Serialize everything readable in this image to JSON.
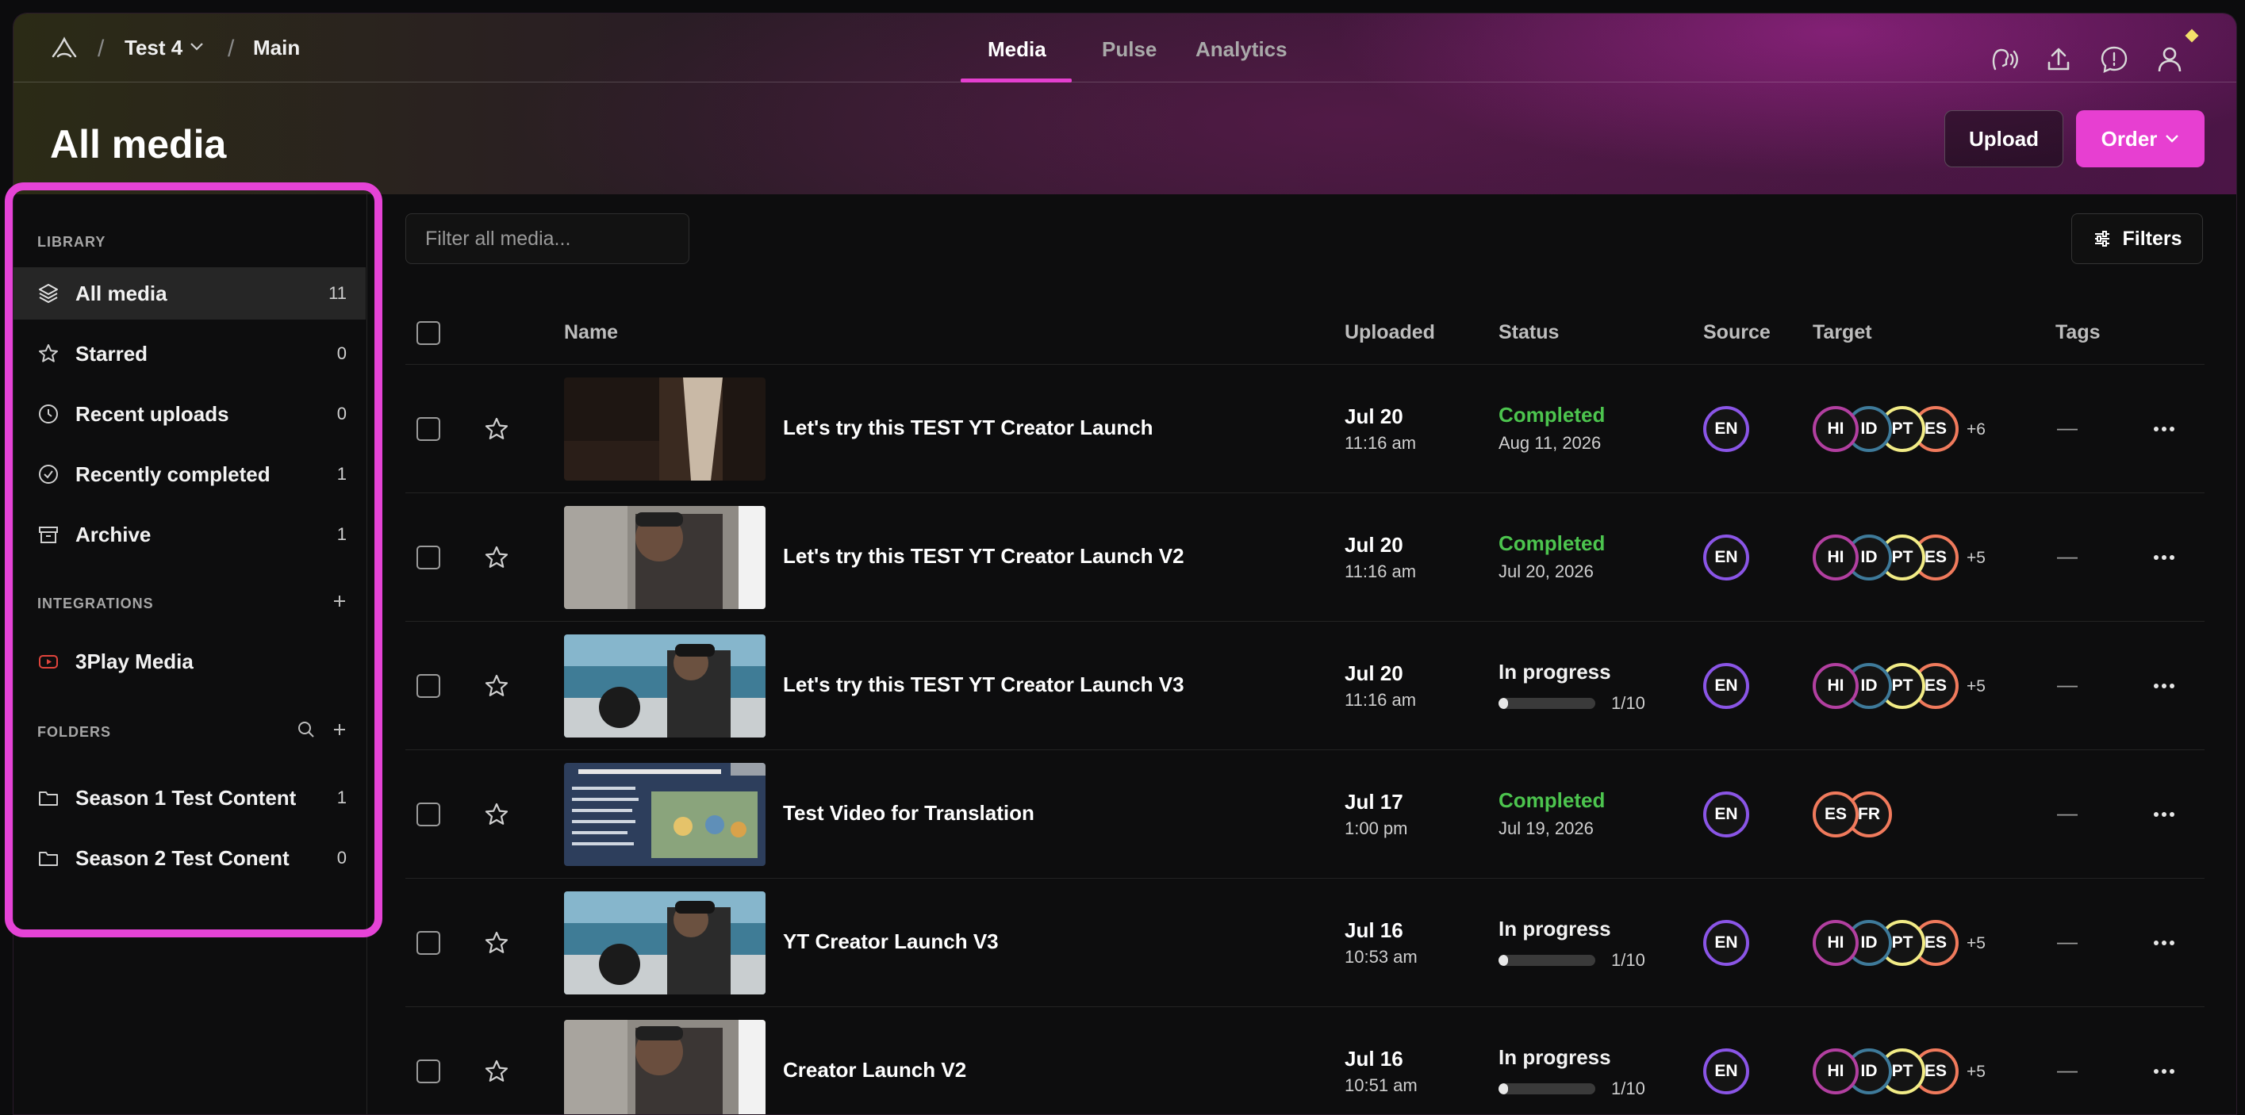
{
  "breadcrumb": {
    "workspace": "Test 4",
    "section": "Main"
  },
  "nav": {
    "tabs": [
      "Media",
      "Pulse",
      "Analytics"
    ],
    "active": "Media"
  },
  "page": {
    "title": "All media",
    "upload_label": "Upload",
    "order_label": "Order"
  },
  "sidebar": {
    "library_label": "LIBRARY",
    "items": [
      {
        "label": "All media",
        "count": "11",
        "icon": "layers-icon"
      },
      {
        "label": "Starred",
        "count": "0",
        "icon": "star-icon"
      },
      {
        "label": "Recent uploads",
        "count": "0",
        "icon": "clock-icon"
      },
      {
        "label": "Recently completed",
        "count": "1",
        "icon": "check-circle-icon"
      },
      {
        "label": "Archive",
        "count": "1",
        "icon": "archive-icon"
      }
    ],
    "integrations_label": "INTEGRATIONS",
    "integrations": [
      {
        "label": "3Play Media",
        "icon": "youtube-icon"
      }
    ],
    "folders_label": "FOLDERS",
    "folders": [
      {
        "label": "Season 1 Test Content",
        "count": "1"
      },
      {
        "label": "Season 2 Test Conent",
        "count": "0"
      }
    ]
  },
  "toolbar": {
    "filter_placeholder": "Filter all media...",
    "filters_label": "Filters"
  },
  "table": {
    "headers": {
      "name": "Name",
      "uploaded": "Uploaded",
      "status": "Status",
      "source": "Source",
      "target": "Target",
      "tags": "Tags"
    },
    "rows": [
      {
        "name": "Let's try this TEST YT Creator Launch",
        "date": "Jul 20",
        "time": "11:16 am",
        "status": "Completed",
        "status_sub": "Aug 11, 2026",
        "progress": null,
        "source": "EN",
        "targets": [
          "HI",
          "ID",
          "PT",
          "ES"
        ],
        "more": "+6",
        "tags": "—",
        "thumb": "dark-room"
      },
      {
        "name": "Let's try this TEST YT Creator Launch V2",
        "date": "Jul 20",
        "time": "11:16 am",
        "status": "Completed",
        "status_sub": "Jul 20, 2026",
        "progress": null,
        "source": "EN",
        "targets": [
          "HI",
          "ID",
          "PT",
          "ES"
        ],
        "more": "+5",
        "tags": "—",
        "thumb": "man-window"
      },
      {
        "name": "Let's try this TEST YT Creator Launch V3",
        "date": "Jul 20",
        "time": "11:16 am",
        "status": "In progress",
        "status_sub": "1/10",
        "progress": 0.1,
        "source": "EN",
        "targets": [
          "HI",
          "ID",
          "PT",
          "ES"
        ],
        "more": "+5",
        "tags": "—",
        "thumb": "boat"
      },
      {
        "name": "Test Video for Translation",
        "date": "Jul 17",
        "time": "1:00 pm",
        "status": "Completed",
        "status_sub": "Jul 19, 2026",
        "progress": null,
        "source": "EN",
        "targets": [
          "ES",
          "FR"
        ],
        "more": "",
        "tags": "—",
        "thumb": "slide"
      },
      {
        "name": "YT Creator Launch V3",
        "date": "Jul 16",
        "time": "10:53 am",
        "status": "In progress",
        "status_sub": "1/10",
        "progress": 0.1,
        "source": "EN",
        "targets": [
          "HI",
          "ID",
          "PT",
          "ES"
        ],
        "more": "+5",
        "tags": "—",
        "thumb": "boat"
      },
      {
        "name": "Creator Launch V2",
        "date": "Jul 16",
        "time": "10:51 am",
        "status": "In progress",
        "status_sub": "1/10",
        "progress": 0.1,
        "source": "EN",
        "targets": [
          "HI",
          "ID",
          "PT",
          "ES"
        ],
        "more": "+5",
        "tags": "—",
        "thumb": "man-window"
      }
    ]
  },
  "colors": {
    "accent": "#e73fd1",
    "completed": "#4cc44e",
    "en": "#8a55e6",
    "hi": "#b23fa0",
    "id": "#3e7a9a",
    "pt": "#f2ec86",
    "es": "#f07a5c",
    "fr": "#f07a5c"
  }
}
